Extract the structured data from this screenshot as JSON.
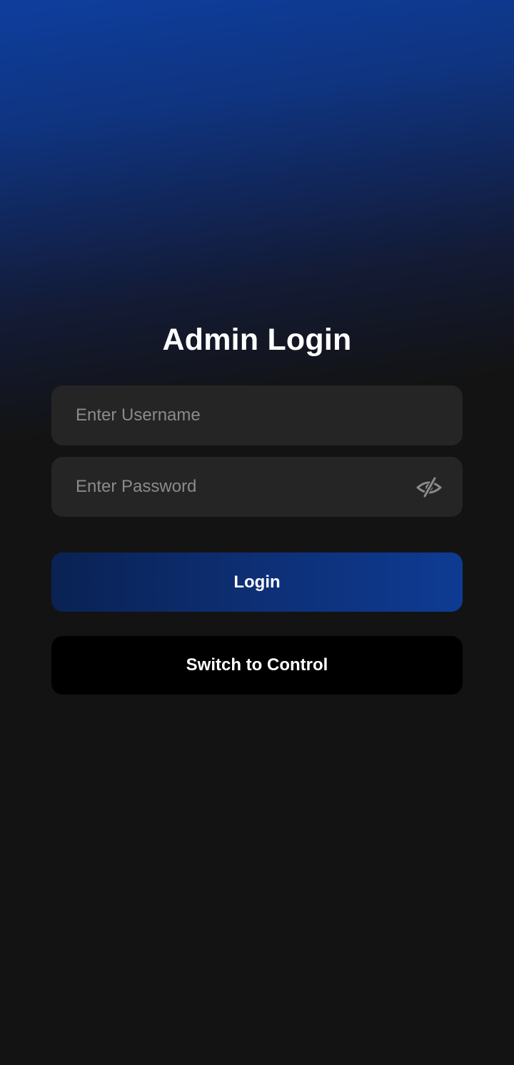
{
  "page": {
    "title": "Admin Login"
  },
  "form": {
    "username_placeholder": "Enter Username",
    "username_value": "",
    "password_placeholder": "Enter Password",
    "password_value": "",
    "password_toggle_icon": "eye-slash-icon"
  },
  "actions": {
    "login_label": "Login",
    "switch_label": "Switch to Control"
  },
  "colors": {
    "background": "#131313",
    "gradient_top": "#0e3e9e",
    "field_background": "#252525",
    "login_button_start": "#0a2253",
    "login_button_end": "#0e3b93",
    "switch_button": "#000000",
    "placeholder": "#8b8b8b",
    "text": "#ffffff"
  }
}
